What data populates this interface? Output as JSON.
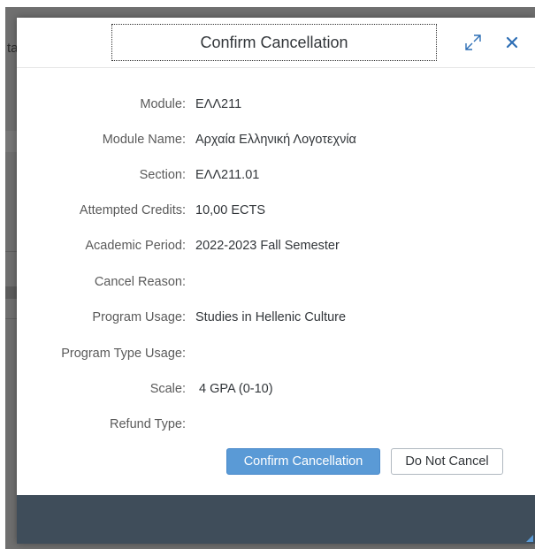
{
  "background": {
    "peek_text": "ta"
  },
  "dialog": {
    "title": "Confirm Cancellation",
    "icons": {
      "resize": "resize-icon",
      "close": "close-icon"
    },
    "fields": [
      {
        "label": "Module:",
        "value": "ΕΛΛ211"
      },
      {
        "label": "Module Name:",
        "value": "Αρχαία Ελληνική Λογοτεχνία"
      },
      {
        "label": "Section:",
        "value": "ΕΛΛ211.01"
      },
      {
        "label": "Attempted Credits:",
        "value": "10,00 ECTS"
      },
      {
        "label": "Academic Period:",
        "value": "2022-2023 Fall Semester"
      },
      {
        "label": "Cancel Reason:",
        "value": ""
      },
      {
        "label": "Program Usage:",
        "value": "Studies in Hellenic Culture"
      },
      {
        "label": "Program Type Usage:",
        "value": ""
      },
      {
        "label": "Scale:",
        "value": " 4 GPA (0-10)"
      },
      {
        "label": "Refund Type:",
        "value": ""
      }
    ],
    "buttons": {
      "confirm": "Confirm Cancellation",
      "do_not_cancel": "Do Not Cancel"
    }
  },
  "colors": {
    "primary_button": "#5a9ad6",
    "footer": "#3f4d5a",
    "backdrop": "#6f6f6f",
    "icon_blue": "#2d6eb5"
  }
}
